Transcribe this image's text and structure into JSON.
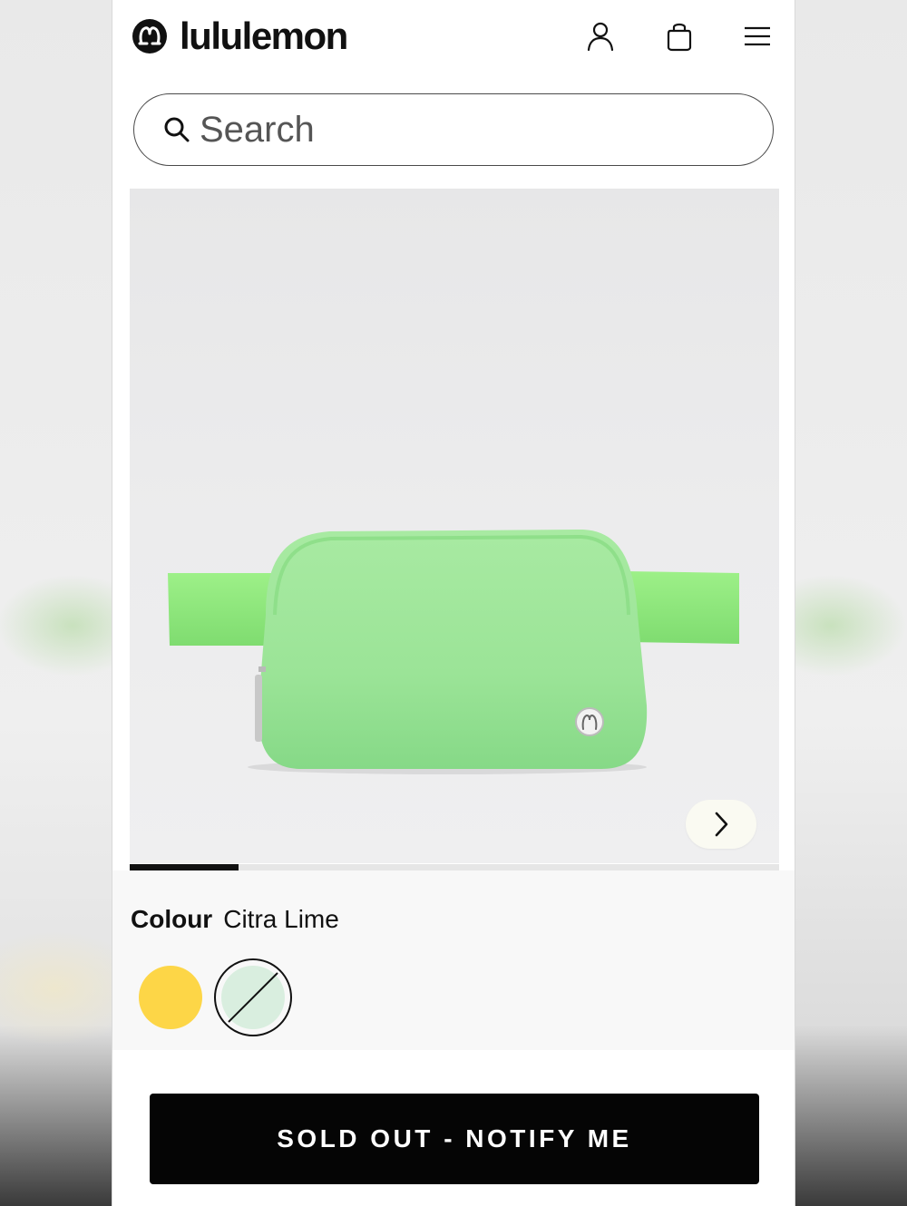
{
  "brand": {
    "name": "lululemon"
  },
  "header": {
    "account_icon": "person-icon",
    "bag_icon": "shopping-bag-icon",
    "menu_icon": "hamburger-menu-icon"
  },
  "search": {
    "placeholder": "Search",
    "value": "",
    "icon": "search-icon"
  },
  "product": {
    "image": "green-belt-bag-photo",
    "image_progress": 0.167,
    "next_icon": "chevron-right-icon"
  },
  "colour": {
    "label": "Colour",
    "selected": "Citra Lime",
    "swatches": [
      {
        "color": "#fdd647",
        "available": true
      },
      {
        "color": "#d9eedf",
        "available": false,
        "selected": true
      }
    ]
  },
  "cta": {
    "label": "SOLD OUT - NOTIFY ME"
  },
  "colors": {
    "bag_body": "#9ee69a",
    "bag_strap": "#8be57a",
    "gallery_bg": "#ececed",
    "cta_bg": "#050505"
  }
}
